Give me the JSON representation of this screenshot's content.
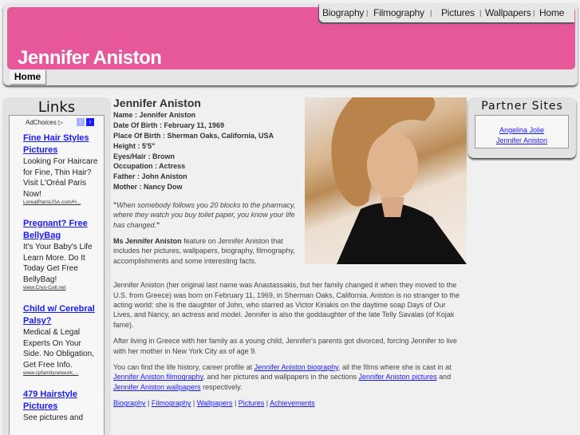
{
  "header": {
    "site_title": "Jennifer Aniston",
    "nav": [
      "Biography",
      "Filmography",
      "Pictures",
      "Wallpapers",
      "Home"
    ],
    "home_tab": "Home"
  },
  "sidebar": {
    "title": "Links",
    "adchoices": "AdChoices ▷",
    "ads": [
      {
        "title": "Fine Hair Styles Pictures",
        "desc": "Looking For Haircare for Fine, Thin Hair? Visit L'Oréal Paris Now!",
        "url": "LorealParisUSA.com/H..."
      },
      {
        "title": "Pregnant? Free BellyBag",
        "desc": "It's Your Baby's Life Learn More. Do It Today Get Free BellyBag!",
        "url": "www.Cryo-Cell.net"
      },
      {
        "title": "Child w/ Cerebral Palsy?",
        "desc": "Medical & Legal Experts On Your Side. No Obligation, Get Free Info.",
        "url": "www.cpfamilynetwork...."
      },
      {
        "title": "479 Hairstyle Pictures",
        "desc": "See pictures and",
        "url": ""
      }
    ]
  },
  "main": {
    "title": "Jennifer Aniston",
    "facts": [
      "Name : Jennifer Aniston",
      "Date Of Birth : February 11, 1969",
      "Place Of Birth : Sherman Oaks, California, USA",
      "Height : 5'5\"",
      "Eyes/Hair : Brown",
      "Occupation : Actress",
      "Father : John Aniston",
      "Mother : Nancy Dow"
    ],
    "quote": "When somebody follows you 20 blocks to the pharmacy, where they watch you buy toilet paper, you know your life has changed.",
    "intro_bold": "Ms Jennifer Aniston",
    "intro_rest": " feature on Jennifer Aniston that includes her pictures, wallpapers, biography, filmography, accomplishments and some interesting facts.",
    "para1": "Jennifer Aniston (her original last name was Anastassakis, but her family changed it when they moved to the U.S. from Greece) was born on February 11, 1969, in Sherman Oaks, California. Aniston is no stranger to the acting world: she is the daughter of John, who starred as Victor Kiriakis on the daytime soap Days of Our Lives, and Nancy, an actress and model. Jennifer is also the goddaughter of the late Telly Savalas (of Kojak fame).",
    "para2": "After living in Greece with her family as a young child, Jennifer's parents got divorced, forcing Jennifer to live with her mother in New York City as of age 9.",
    "para3": {
      "t1": "You can find the life history, career profile at ",
      "l1": "Jennifer Aniston biography",
      "t2": ", all the films where she is cast in at ",
      "l2": "Jennifer Aniston filmography",
      "t3": ", and her pictures and wallpapers in the sections ",
      "l3": "Jennifer Aniston pictures",
      "t4": " and ",
      "l4": "Jennifer Aniston wallpapers",
      "t5": " respectively."
    },
    "footer_links": [
      "Biography",
      "Filmography",
      "Wallpapers",
      "Pictures",
      "Achievements"
    ]
  },
  "partners": {
    "title": "Partner Sites",
    "links": [
      "Angelina Jolie",
      "Jennifer Aniston"
    ]
  }
}
